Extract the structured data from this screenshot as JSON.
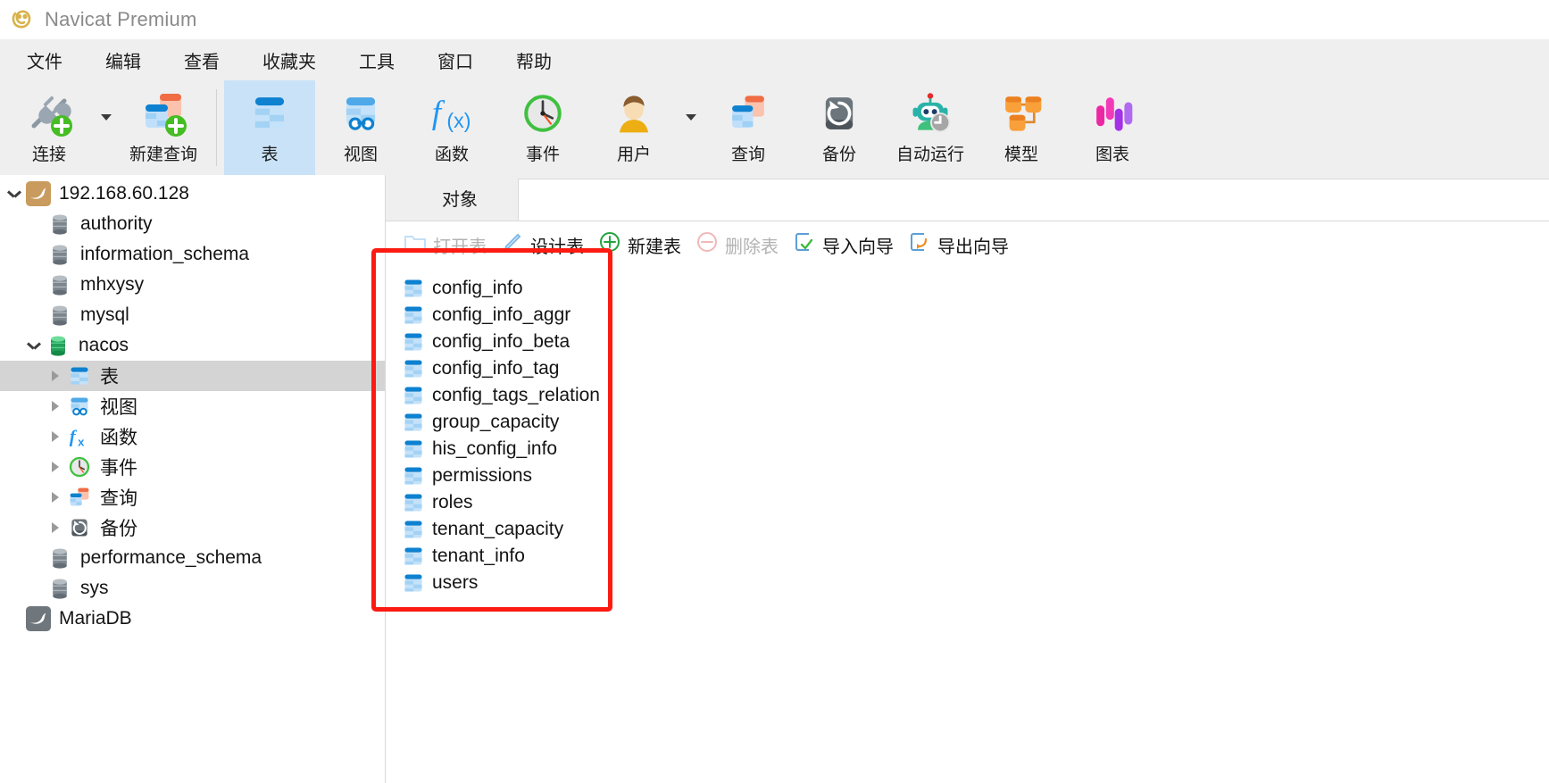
{
  "window": {
    "title": "Navicat Premium",
    "logo_icon": "navicat-logo-icon"
  },
  "menubar": {
    "items": [
      {
        "label": "文件",
        "name": "menu-file"
      },
      {
        "label": "编辑",
        "name": "menu-edit"
      },
      {
        "label": "查看",
        "name": "menu-view"
      },
      {
        "label": "收藏夹",
        "name": "menu-favorites"
      },
      {
        "label": "工具",
        "name": "menu-tools"
      },
      {
        "label": "窗口",
        "name": "menu-window"
      },
      {
        "label": "帮助",
        "name": "menu-help"
      }
    ]
  },
  "ribbon": {
    "items": [
      {
        "label": "连接",
        "icon": "connection-plug-add-icon",
        "active": false,
        "caret": true
      },
      {
        "label": "新建查询",
        "icon": "new-query-add-icon",
        "active": false,
        "caret": false
      },
      {
        "label": "表",
        "icon": "table-icon",
        "active": true,
        "caret": false
      },
      {
        "label": "视图",
        "icon": "view-glasses-icon",
        "active": false,
        "caret": false
      },
      {
        "label": "函数",
        "icon": "function-fx-icon",
        "active": false,
        "caret": false
      },
      {
        "label": "事件",
        "icon": "event-clock-icon",
        "active": false,
        "caret": false
      },
      {
        "label": "用户",
        "icon": "user-person-icon",
        "active": false,
        "caret": true
      },
      {
        "label": "查询",
        "icon": "query-icon",
        "active": false,
        "caret": false
      },
      {
        "label": "备份",
        "icon": "backup-restore-icon",
        "active": false,
        "caret": false
      },
      {
        "label": "自动运行",
        "icon": "automation-robot-icon",
        "active": false,
        "caret": false
      },
      {
        "label": "模型",
        "icon": "model-nodes-icon",
        "active": false,
        "caret": false
      },
      {
        "label": "图表",
        "icon": "chart-bars-icon",
        "active": false,
        "caret": false
      }
    ]
  },
  "sidebar": {
    "nodes": [
      {
        "label": "192.168.60.128",
        "icon": "mysql-dolphin-icon",
        "indent": 0,
        "twisty": "down",
        "selected": false
      },
      {
        "label": "authority",
        "icon": "database-gray-icon",
        "indent": 1,
        "twisty": "none",
        "selected": false
      },
      {
        "label": "information_schema",
        "icon": "database-gray-icon",
        "indent": 1,
        "twisty": "none",
        "selected": false
      },
      {
        "label": "mhxysy",
        "icon": "database-gray-icon",
        "indent": 1,
        "twisty": "none",
        "selected": false
      },
      {
        "label": "mysql",
        "icon": "database-gray-icon",
        "indent": 1,
        "twisty": "none",
        "selected": false
      },
      {
        "label": "nacos",
        "icon": "database-green-icon",
        "indent": 1,
        "twisty": "down",
        "selected": false
      },
      {
        "label": "表",
        "icon": "table-icon",
        "indent": 2,
        "twisty": "right",
        "selected": true
      },
      {
        "label": "视图",
        "icon": "view-glasses-icon",
        "indent": 2,
        "twisty": "right",
        "selected": false
      },
      {
        "label": "函数",
        "icon": "function-fx-icon",
        "indent": 2,
        "twisty": "right",
        "selected": false
      },
      {
        "label": "事件",
        "icon": "event-clock-icon",
        "indent": 2,
        "twisty": "right",
        "selected": false
      },
      {
        "label": "查询",
        "icon": "query-icon",
        "indent": 2,
        "twisty": "right",
        "selected": false
      },
      {
        "label": "备份",
        "icon": "backup-restore-icon",
        "indent": 2,
        "twisty": "right",
        "selected": false
      },
      {
        "label": "performance_schema",
        "icon": "database-gray-icon",
        "indent": 1,
        "twisty": "none",
        "selected": false
      },
      {
        "label": "sys",
        "icon": "database-gray-icon",
        "indent": 1,
        "twisty": "none",
        "selected": false
      },
      {
        "label": "MariaDB",
        "icon": "mariadb-seal-icon",
        "indent": 0,
        "twisty": "none",
        "selected": false
      }
    ]
  },
  "main": {
    "tabs": [
      {
        "label": "对象",
        "active": true
      }
    ],
    "actions": [
      {
        "label": "打开表",
        "icon": "open-folder-icon",
        "disabled": true
      },
      {
        "label": "设计表",
        "icon": "pencil-design-icon",
        "disabled": false
      },
      {
        "label": "新建表",
        "icon": "plus-circle-icon",
        "disabled": false
      },
      {
        "label": "删除表",
        "icon": "minus-circle-icon",
        "disabled": true
      },
      {
        "label": "导入向导",
        "icon": "import-wizard-icon",
        "disabled": false
      },
      {
        "label": "导出向导",
        "icon": "export-wizard-icon",
        "disabled": false
      }
    ],
    "tables": [
      {
        "name": "config_info"
      },
      {
        "name": "config_info_aggr"
      },
      {
        "name": "config_info_beta"
      },
      {
        "name": "config_info_tag"
      },
      {
        "name": "config_tags_relation"
      },
      {
        "name": "group_capacity"
      },
      {
        "name": "his_config_info"
      },
      {
        "name": "permissions"
      },
      {
        "name": "roles"
      },
      {
        "name": "tenant_capacity"
      },
      {
        "name": "tenant_info"
      },
      {
        "name": "users"
      }
    ]
  },
  "annotation": {
    "highlight_color": "#fc1b13",
    "name": "table-list-highlight-box"
  }
}
